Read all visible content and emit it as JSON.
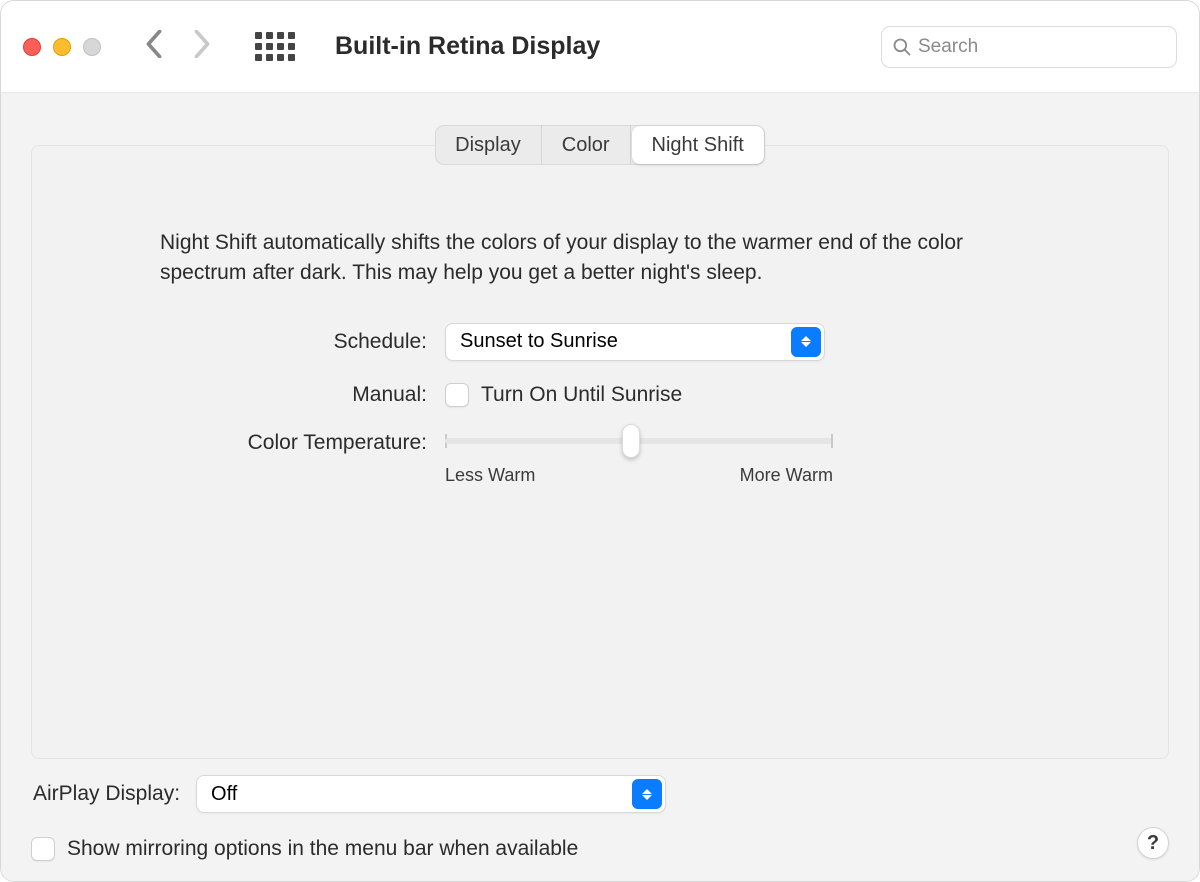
{
  "header": {
    "title": "Built-in Retina Display",
    "search_placeholder": "Search"
  },
  "tabs": {
    "items": [
      "Display",
      "Color",
      "Night Shift"
    ],
    "active_index": 2
  },
  "nightshift": {
    "description": "Night Shift automatically shifts the colors of your display to the warmer end of the color spectrum after dark. This may help you get a better night's sleep.",
    "schedule_label": "Schedule:",
    "schedule_value": "Sunset to Sunrise",
    "manual_label": "Manual:",
    "manual_checkbox_label": "Turn On Until Sunrise",
    "manual_checked": false,
    "colortemp_label": "Color Temperature:",
    "slider_min_label": "Less Warm",
    "slider_max_label": "More Warm",
    "slider_value_percent": 50
  },
  "airplay": {
    "label": "AirPlay Display:",
    "value": "Off"
  },
  "mirroring": {
    "label": "Show mirroring options in the menu bar when available",
    "checked": false
  },
  "help_symbol": "?"
}
